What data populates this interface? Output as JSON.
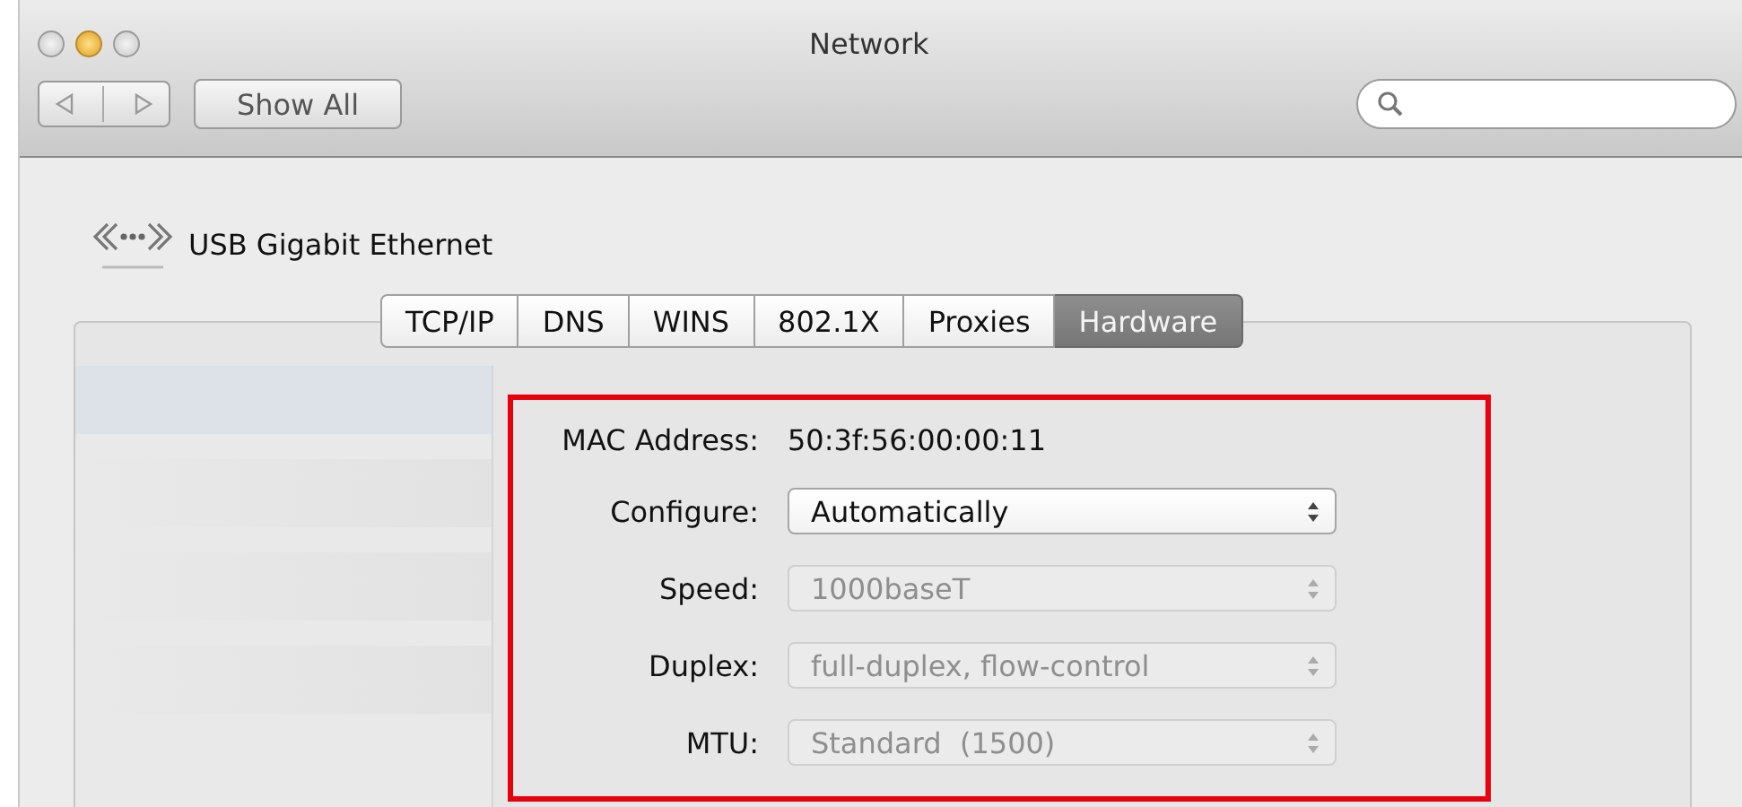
{
  "window": {
    "title": "Network"
  },
  "toolbar": {
    "show_all": "Show All"
  },
  "service": {
    "name": "USB Gigabit Ethernet"
  },
  "tabs": [
    {
      "label": "TCP/IP",
      "selected": false
    },
    {
      "label": "DNS",
      "selected": false
    },
    {
      "label": "WINS",
      "selected": false
    },
    {
      "label": "802.1X",
      "selected": false
    },
    {
      "label": "Proxies",
      "selected": false
    },
    {
      "label": "Hardware",
      "selected": true
    }
  ],
  "fields": [
    {
      "kind": "text",
      "label": "MAC Address:",
      "value": "50:3f:56:00:00:11",
      "disabled": false
    },
    {
      "kind": "popup",
      "label": "Configure:",
      "value": "Automatically",
      "disabled": false
    },
    {
      "kind": "popup",
      "label": "Speed:",
      "value": "1000baseT",
      "disabled": true
    },
    {
      "kind": "popup",
      "label": "Duplex:",
      "value": "full-duplex, flow-control",
      "disabled": true
    },
    {
      "kind": "popup",
      "label": "MTU:",
      "value": "Standard  (1500)",
      "disabled": true
    }
  ]
}
